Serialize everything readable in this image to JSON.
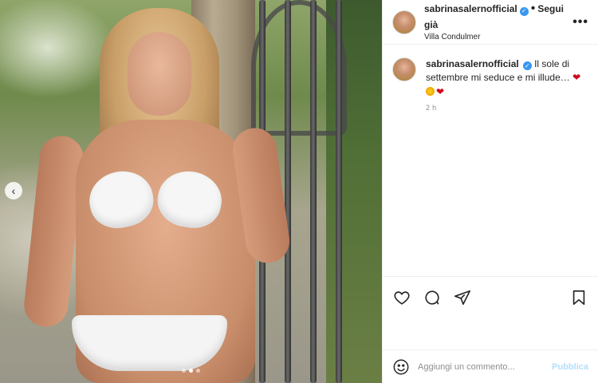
{
  "post": {
    "author": {
      "username": "sabrinasalernofficial",
      "verified": true,
      "follow_status": "Segui già",
      "location": "Villa Condulmer"
    },
    "header_separator": "•",
    "more_icon": "more-horizontal-icon",
    "caption": {
      "text": "Il sole di settembre mi seduce e mi illude…",
      "emojis": [
        "red-heart-emoji",
        "sun-emoji",
        "red-heart-emoji"
      ],
      "heart_char": "❤",
      "time": "2 h"
    },
    "carousel": {
      "prev_arrow": "‹",
      "dots_count": 3,
      "active_index": 1
    },
    "actions": {
      "like_icon": "heart-icon",
      "comment_icon": "comment-icon",
      "share_icon": "paper-plane-icon",
      "save_icon": "bookmark-icon"
    },
    "composer": {
      "emoji_icon": "smiley-icon",
      "placeholder": "Aggiungi un commento...",
      "publish_label": "Pubblica"
    }
  },
  "colors": {
    "text": "#262626",
    "secondary": "#8e8e8e",
    "verified": "#3897f0",
    "publish_disabled": "#b2dffc",
    "heart": "#d0021b"
  }
}
